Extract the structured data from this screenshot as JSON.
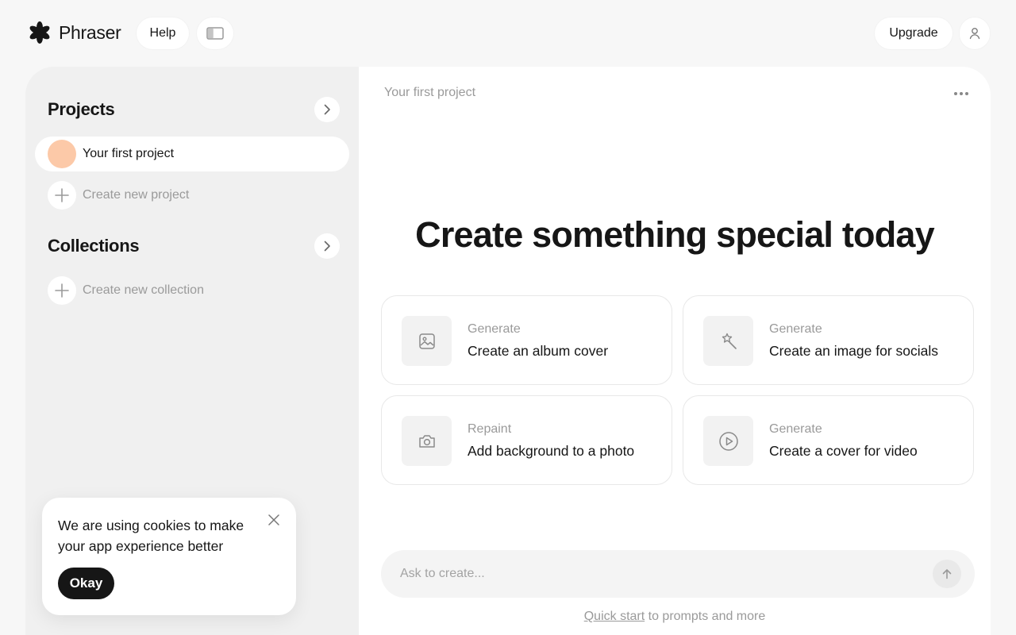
{
  "brand": {
    "name": "Phraser",
    "logo_icon": "asterisk-flower-icon"
  },
  "header": {
    "help_label": "Help",
    "sidebar_toggle_icon": "sidebar-panel-icon",
    "upgrade_label": "Upgrade",
    "user_icon": "user-icon"
  },
  "sidebar": {
    "projects_title": "Projects",
    "projects": [
      {
        "label": "Your first project",
        "avatar_color": "#fcc9a8",
        "selected": true
      }
    ],
    "create_project_label": "Create new project",
    "collections_title": "Collections",
    "create_collection_label": "Create new collection"
  },
  "cookie": {
    "message": "We are using cookies to make your app experience better",
    "okay_label": "Okay"
  },
  "main": {
    "breadcrumb": "Your first project",
    "headline": "Create something special today",
    "cards": [
      {
        "kicker": "Generate",
        "title": "Create an album cover",
        "icon": "image-icon"
      },
      {
        "kicker": "Generate",
        "title": "Create an image for socials",
        "icon": "magic-wand-icon"
      },
      {
        "kicker": "Repaint",
        "title": "Add background to a photo",
        "icon": "camera-icon"
      },
      {
        "kicker": "Generate",
        "title": "Create a cover for video",
        "icon": "play-circle-icon"
      }
    ],
    "prompt": {
      "placeholder": "Ask to create...",
      "value": ""
    },
    "footer": {
      "link": "Quick start",
      "rest": " to prompts and more"
    }
  },
  "colors": {
    "background": "#f7f7f7",
    "sidebar": "#f0f0f0",
    "panel": "#ffffff",
    "accent_dark": "#161616",
    "avatar": "#fcc9a8",
    "muted_text": "#9a9a9a"
  }
}
